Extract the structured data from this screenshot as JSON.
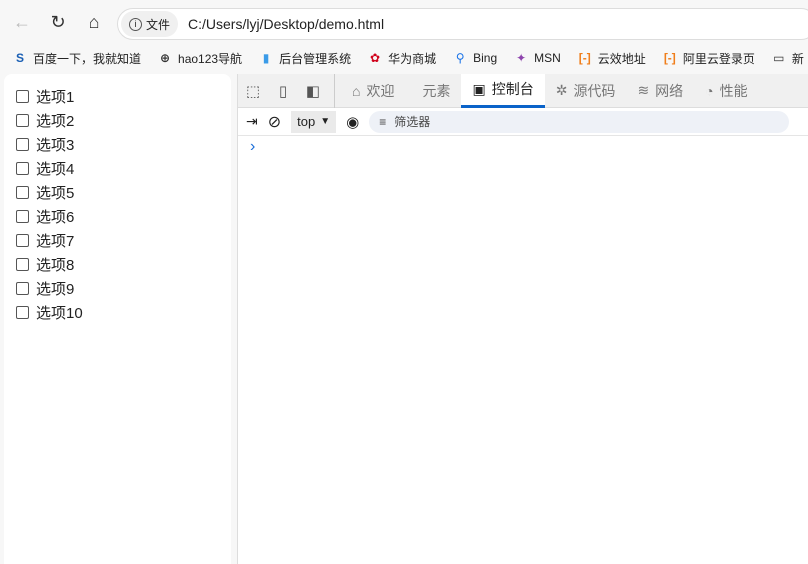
{
  "toolbar": {
    "back_icon": "back-arrow-icon",
    "reload_icon": "reload-icon",
    "home_icon": "home-icon",
    "security_label": "文件",
    "url": "C:/Users/lyj/Desktop/demo.html"
  },
  "bookmarks": [
    {
      "label": "百度一下，我就知道",
      "icon": "S",
      "color": "#1a5fb4"
    },
    {
      "label": "hao123导航",
      "icon": "⊕",
      "color": "#333"
    },
    {
      "label": "后台管理系统",
      "icon": "▮",
      "color": "#3a9be8"
    },
    {
      "label": "华为商城",
      "icon": "✿",
      "color": "#d0021b"
    },
    {
      "label": "Bing",
      "icon": "⚲",
      "color": "#1a73e8"
    },
    {
      "label": "MSN",
      "icon": "✦",
      "color": "#8e44ad"
    },
    {
      "label": "云效地址",
      "icon": "[-]",
      "color": "#f07e1b"
    },
    {
      "label": "阿里云登录页",
      "icon": "[-]",
      "color": "#f07e1b"
    },
    {
      "label": "新",
      "icon": "▭",
      "color": "#333"
    }
  ],
  "options": [
    "选项1",
    "选项2",
    "选项3",
    "选项4",
    "选项5",
    "选项6",
    "选项7",
    "选项8",
    "选项9",
    "选项10"
  ],
  "devtools": {
    "tabs": [
      {
        "label": "欢迎",
        "icon": "⌂"
      },
      {
        "label": "元素",
        "icon": "</>"
      },
      {
        "label": "控制台",
        "icon": "▣"
      },
      {
        "label": "源代码",
        "icon": "✲"
      },
      {
        "label": "网络",
        "icon": "≋"
      },
      {
        "label": "性能",
        "icon": "◔"
      }
    ],
    "active_tab": "控制台",
    "context": "top",
    "filter_placeholder": "筛选器",
    "prompt": "›"
  },
  "colors": {
    "accent": "#0a63c9"
  }
}
